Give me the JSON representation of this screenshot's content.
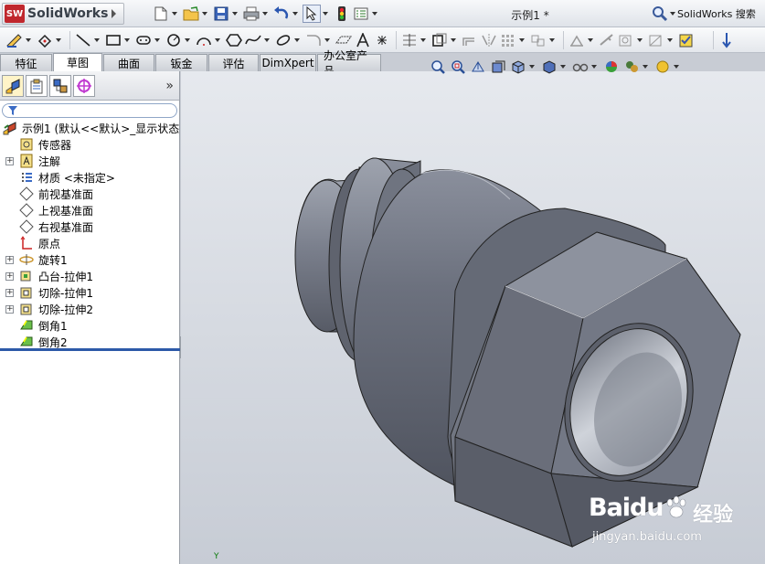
{
  "app": {
    "name": "SolidWorks",
    "logo_mark": "SW",
    "document_title": "示例1 *",
    "search_label": "SolidWorks 搜索"
  },
  "quick_access": {
    "icons": [
      "new-document-icon",
      "open-folder-icon",
      "save-icon",
      "print-icon",
      "undo-icon",
      "select-pointer-icon",
      "rebuild-traffic-light-icon",
      "options-icon"
    ]
  },
  "command_tools": {
    "icons": [
      "sketch-icon",
      "smart-dimension-icon",
      "line-icon",
      "rectangle-icon",
      "slot-icon",
      "circle-icon",
      "arc-icon",
      "polygon-icon",
      "spline-icon",
      "ellipse-icon",
      "fillet-icon",
      "plane-icon",
      "text-icon",
      "point-icon",
      "trim-icon",
      "convert-entities-icon",
      "offset-icon",
      "mirror-icon",
      "pattern-icon",
      "move-entities-icon",
      "display-relations-icon",
      "repair-sketch-icon",
      "quick-snaps-icon",
      "rapid-sketch-icon",
      "instant3d-icon"
    ]
  },
  "tabs": [
    {
      "label": "特征"
    },
    {
      "label": "草图"
    },
    {
      "label": "曲面"
    },
    {
      "label": "钣金"
    },
    {
      "label": "评估"
    },
    {
      "label": "DimXpert"
    },
    {
      "label": "办公室产品"
    }
  ],
  "active_tab": "草图",
  "view_tools": {
    "icons": [
      "zoom-to-fit-icon",
      "zoom-area-icon",
      "previous-view-icon",
      "section-view-icon",
      "view-orientation-icon",
      "display-style-icon",
      "hide-show-icon",
      "edit-appearance-icon",
      "apply-scene-icon",
      "view-settings-icon"
    ]
  },
  "panel": {
    "tabs": [
      "feature-manager-icon",
      "property-manager-icon",
      "configuration-manager-icon",
      "dimxpert-manager-icon"
    ],
    "expand_glyph": "»"
  },
  "tree": {
    "root": "示例1  (默认<<默认>_显示状态",
    "items": [
      {
        "label": "传感器",
        "icon": "sensor-icon",
        "expandable": false
      },
      {
        "label": "注解",
        "icon": "annotations-icon",
        "expandable": true
      },
      {
        "label": "材质 <未指定>",
        "icon": "material-icon",
        "expandable": false
      },
      {
        "label": "前视基准面",
        "icon": "plane-icon",
        "expandable": false
      },
      {
        "label": "上视基准面",
        "icon": "plane-icon",
        "expandable": false
      },
      {
        "label": "右视基准面",
        "icon": "plane-icon",
        "expandable": false
      },
      {
        "label": "原点",
        "icon": "origin-icon",
        "expandable": false
      },
      {
        "label": "旋转1",
        "icon": "revolve-icon",
        "expandable": true
      },
      {
        "label": "凸台-拉伸1",
        "icon": "boss-extrude-icon",
        "expandable": true
      },
      {
        "label": "切除-拉伸1",
        "icon": "cut-extrude-icon",
        "expandable": true
      },
      {
        "label": "切除-拉伸2",
        "icon": "cut-extrude-icon",
        "expandable": true
      },
      {
        "label": "倒角1",
        "icon": "chamfer-icon",
        "expandable": false
      },
      {
        "label": "倒角2",
        "icon": "chamfer-icon",
        "expandable": false
      }
    ]
  },
  "viewport": {
    "triad_label": "Y",
    "model": "hex-nut-fitting-model"
  },
  "watermark": {
    "brand": "Baidu",
    "cn": "经验",
    "url": "jingyan.baidu.com"
  },
  "colors": {
    "brand_red": "#c0272d",
    "model_steel": "#6a6f7d",
    "selection_blue": "#2d59a8"
  }
}
